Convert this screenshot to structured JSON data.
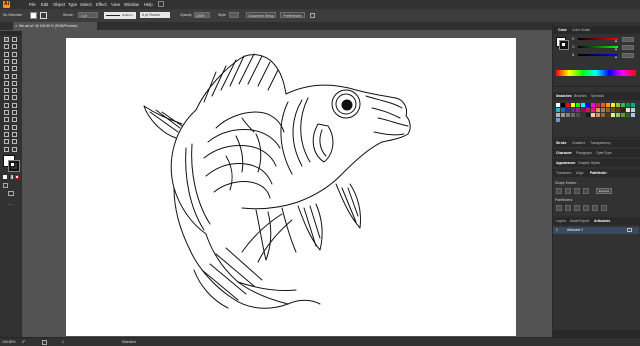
{
  "app": {
    "logo_text": "Ai"
  },
  "menu": [
    "File",
    "Edit",
    "Object",
    "Type",
    "Select",
    "Effect",
    "View",
    "Window",
    "Help"
  ],
  "control_bar": {
    "selection_label": "No Selection",
    "stroke_label": "Stroke:",
    "stroke_value": "1 pt",
    "profile_label": "Uniform",
    "brush_label": "5 pt. Round",
    "opacity_label": "Opacity:",
    "opacity_value": "100%",
    "style_label": "Style:",
    "document_setup": "Document Setup",
    "preferences": "Preferences"
  },
  "document_tab": {
    "title": "fish-art.ai* @ 106.55 % (RGB/Preview)",
    "close_glyph": "×"
  },
  "panels": {
    "color": {
      "tabs": [
        "Color",
        "Color Guide"
      ],
      "channels": [
        "R",
        "G",
        "B"
      ]
    },
    "swatches": {
      "tabs": [
        "Swatches",
        "Brushes",
        "Symbols"
      ]
    },
    "stroke": {
      "tabs": [
        "Stroke",
        "Gradient",
        "Transparency"
      ]
    },
    "character": {
      "tabs": [
        "Character",
        "Paragraph",
        "OpenType"
      ]
    },
    "appearance": {
      "tabs": [
        "Appearance",
        "Graphic Styles"
      ]
    },
    "pathfinder": {
      "tabs": [
        "Transform",
        "Align",
        "Pathfinder"
      ],
      "shape_modes_label": "Shape Modes:",
      "expand_label": "Expand",
      "pathfinders_label": "Pathfinders:"
    },
    "layers": {
      "tabs": [
        "Layers",
        "Asset Export",
        "Artboards"
      ],
      "artboard_number": "1",
      "artboard_name": "Artboard 1"
    }
  },
  "status": {
    "zoom": "106.55%",
    "rotation": "0°",
    "artboard_number": "1",
    "tool": "Selection"
  },
  "colors": {
    "accent": "#2d7df6",
    "app_orange": "#ff9a00"
  },
  "swatch_colors": [
    "#ffffff",
    "#000000",
    "#ff0000",
    "#ffff00",
    "#00ff00",
    "#00ffff",
    "#0000ff",
    "#ff00ff",
    "#e01f26",
    "#f15a24",
    "#f7931e",
    "#fcee21",
    "#8cc63f",
    "#39b54a",
    "#009245",
    "#00a99d",
    "#29abe2",
    "#0071bc",
    "#2e3192",
    "#662d91",
    "#93278f",
    "#9e005d",
    "#d4145a",
    "#ed1e79",
    "#c69c6d",
    "#a67c52",
    "#8c6239",
    "#754c24",
    "#603813",
    "#42210b",
    "#e6e6e6",
    "#cccccc",
    "#b3b3b3",
    "#999999",
    "#808080",
    "#666666",
    "#4d4d4d",
    "#333333",
    "#1a1a1a",
    "#ffcc99",
    "#cc9966",
    "#996633",
    "#663300",
    "#ccff99",
    "#99cc66",
    "#669933",
    "#336600",
    "#99ccff",
    "#6699cc"
  ]
}
